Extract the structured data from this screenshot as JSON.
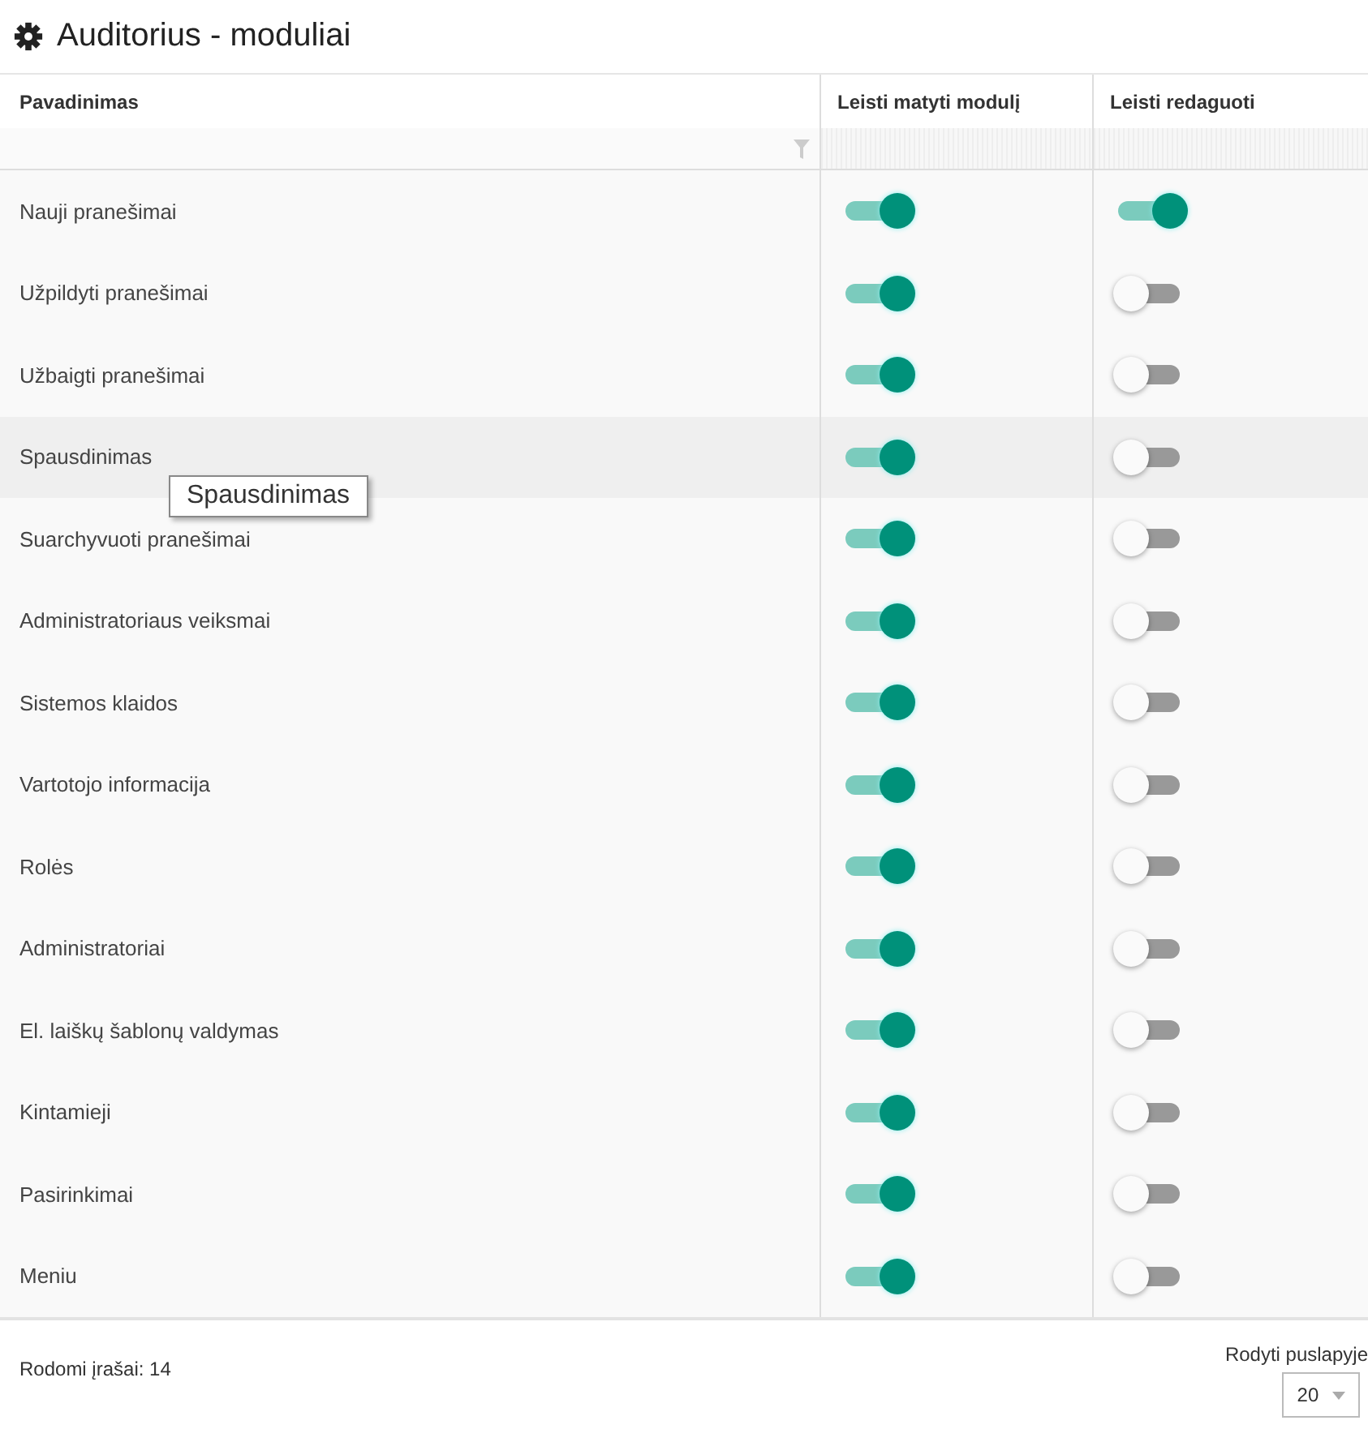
{
  "title": "Auditorius - moduliai",
  "table": {
    "columns": [
      "Pavadinimas",
      "Leisti matyti modulį",
      "Leisti redaguoti"
    ],
    "rows": [
      {
        "name": "Nauji pranešimai",
        "view": true,
        "edit": true,
        "hovered": false
      },
      {
        "name": "Užpildyti pranešimai",
        "view": true,
        "edit": false,
        "hovered": false
      },
      {
        "name": "Užbaigti pranešimai",
        "view": true,
        "edit": false,
        "hovered": false
      },
      {
        "name": "Spausdinimas",
        "view": true,
        "edit": false,
        "hovered": true
      },
      {
        "name": "Suarchyvuoti pranešimai",
        "view": true,
        "edit": false,
        "hovered": false
      },
      {
        "name": "Administratoriaus veiksmai",
        "view": true,
        "edit": false,
        "hovered": false
      },
      {
        "name": "Sistemos klaidos",
        "view": true,
        "edit": false,
        "hovered": false
      },
      {
        "name": "Vartotojo informacija",
        "view": true,
        "edit": false,
        "hovered": false
      },
      {
        "name": "Rolės",
        "view": true,
        "edit": false,
        "hovered": false
      },
      {
        "name": "Administratoriai",
        "view": true,
        "edit": false,
        "hovered": false
      },
      {
        "name": "El. laiškų šablonų valdymas",
        "view": true,
        "edit": false,
        "hovered": false
      },
      {
        "name": "Kintamieji",
        "view": true,
        "edit": false,
        "hovered": false
      },
      {
        "name": "Pasirinkimai",
        "view": true,
        "edit": false,
        "hovered": false
      },
      {
        "name": "Meniu",
        "view": true,
        "edit": false,
        "hovered": false
      }
    ]
  },
  "tooltip": {
    "text": "Spausdinimas"
  },
  "footer": {
    "count": "Rodomi įrašai: 14",
    "page_size_label": "Rodyti puslapyje",
    "page_size": "20"
  }
}
